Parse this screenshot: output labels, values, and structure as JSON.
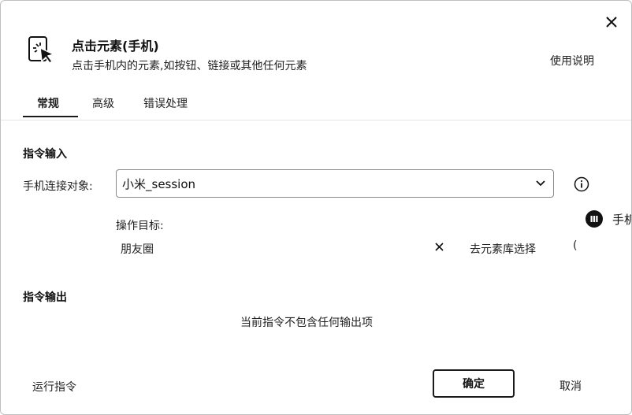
{
  "header": {
    "title": "点击元素(手机)",
    "subtitle": "点击手机内的元素,如按钮、链接或其他任何元素",
    "help_link": "使用说明",
    "icon": "pointer-click-icon"
  },
  "tabs": [
    {
      "label": "常规",
      "active": true
    },
    {
      "label": "高级",
      "active": false
    },
    {
      "label": "错误处理",
      "active": false
    }
  ],
  "input_section": {
    "title": "指令输入",
    "phone_label": "手机连接对象:",
    "phone_value": "小米_session",
    "phone_badge": "手机",
    "target_label": "操作目标:",
    "target_value": "朋友圈",
    "element_library_button": "去元素库选择",
    "clipped_glyph": "("
  },
  "output_section": {
    "title": "指令输出",
    "empty_text": "当前指令不包含任何输出项"
  },
  "footer": {
    "run_label": "运行指令",
    "ok_label": "确定",
    "cancel_label": "取消"
  },
  "colors": {
    "border": "#1a1a1a",
    "text": "#222222"
  }
}
